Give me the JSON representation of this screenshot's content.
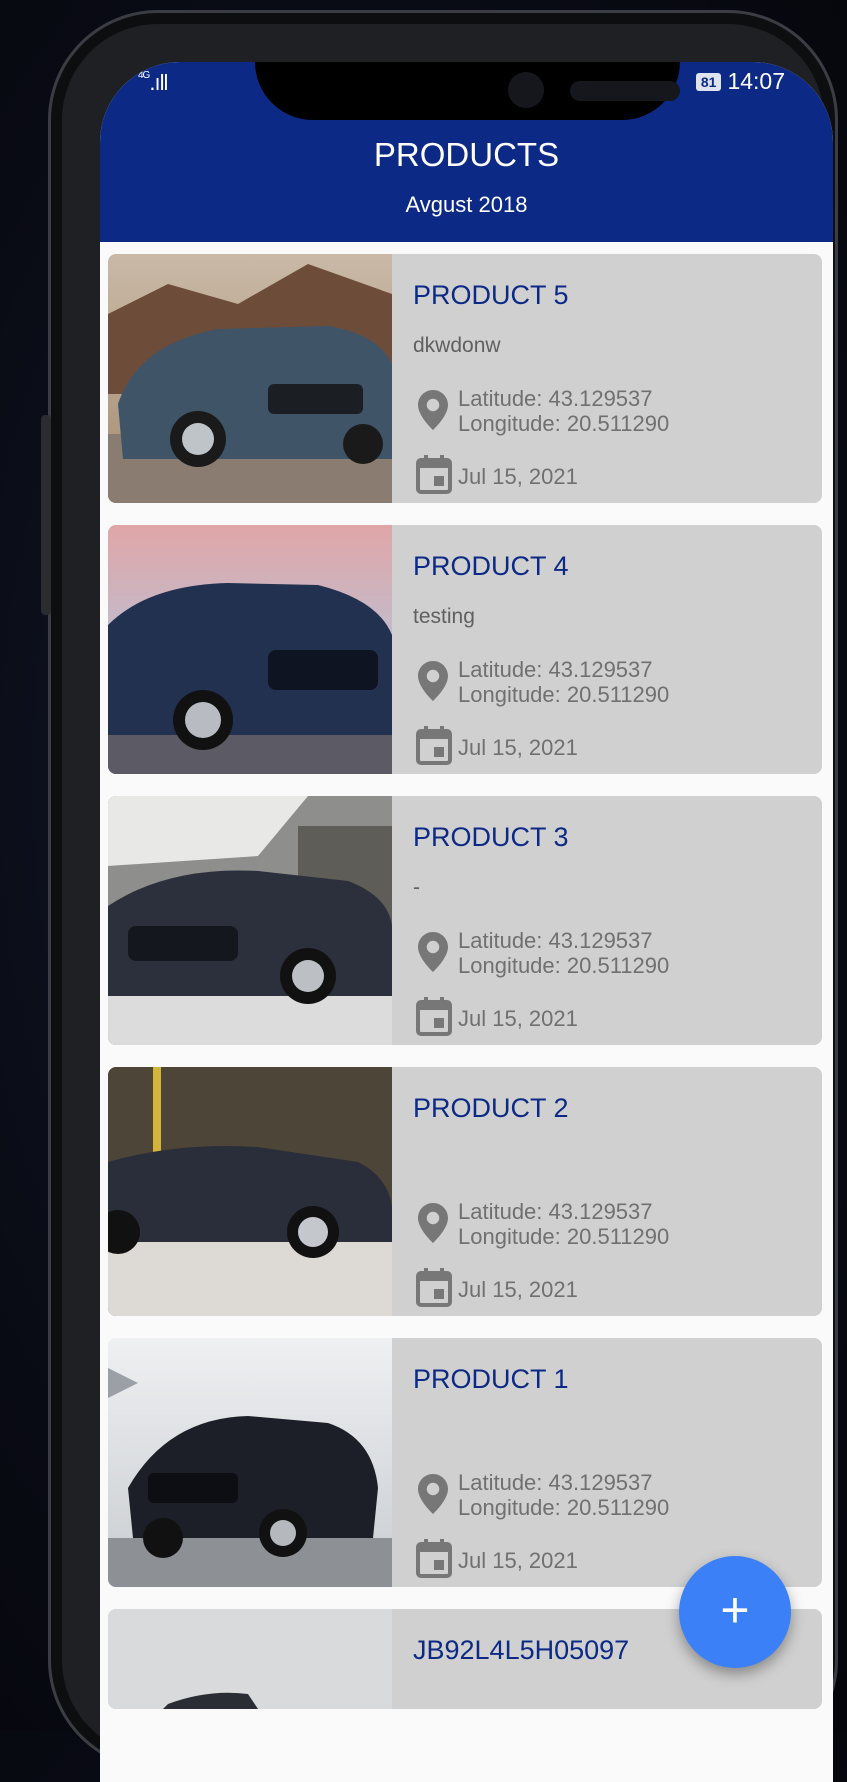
{
  "status_bar": {
    "network": "4G",
    "signal": ".ıll",
    "battery": "81",
    "time": "14:07"
  },
  "appbar": {
    "title": "PRODUCTS",
    "subtitle": "Avgust 2018"
  },
  "products": [
    {
      "title": "PRODUCT 5",
      "description": "dkwdonw",
      "latitude": "Latitude: 43.129537",
      "longitude": "Longitude: 20.511290",
      "date": "Jul 15, 2021"
    },
    {
      "title": "PRODUCT 4",
      "description": "testing",
      "latitude": "Latitude: 43.129537",
      "longitude": "Longitude: 20.511290",
      "date": "Jul 15, 2021"
    },
    {
      "title": "PRODUCT 3",
      "description": "-",
      "latitude": "Latitude: 43.129537",
      "longitude": "Longitude: 20.511290",
      "date": "Jul 15, 2021"
    },
    {
      "title": "PRODUCT 2",
      "description": "",
      "latitude": "Latitude: 43.129537",
      "longitude": "Longitude: 20.511290",
      "date": "Jul 15, 2021"
    },
    {
      "title": "PRODUCT 1",
      "description": "",
      "latitude": "Latitude: 43.129537",
      "longitude": "Longitude: 20.511290",
      "date": "Jul 15, 2021"
    },
    {
      "title": "JB92L4L5H05097"
    }
  ],
  "fab": {
    "label": "+",
    "icon": "plus-icon"
  },
  "icons": {
    "location": "location-pin-icon",
    "date": "calendar-icon"
  },
  "colors": {
    "appbar": "#0c2a85",
    "card_bg": "#d0d0d0",
    "title": "#0c2a85",
    "fab": "#3b80f6"
  }
}
